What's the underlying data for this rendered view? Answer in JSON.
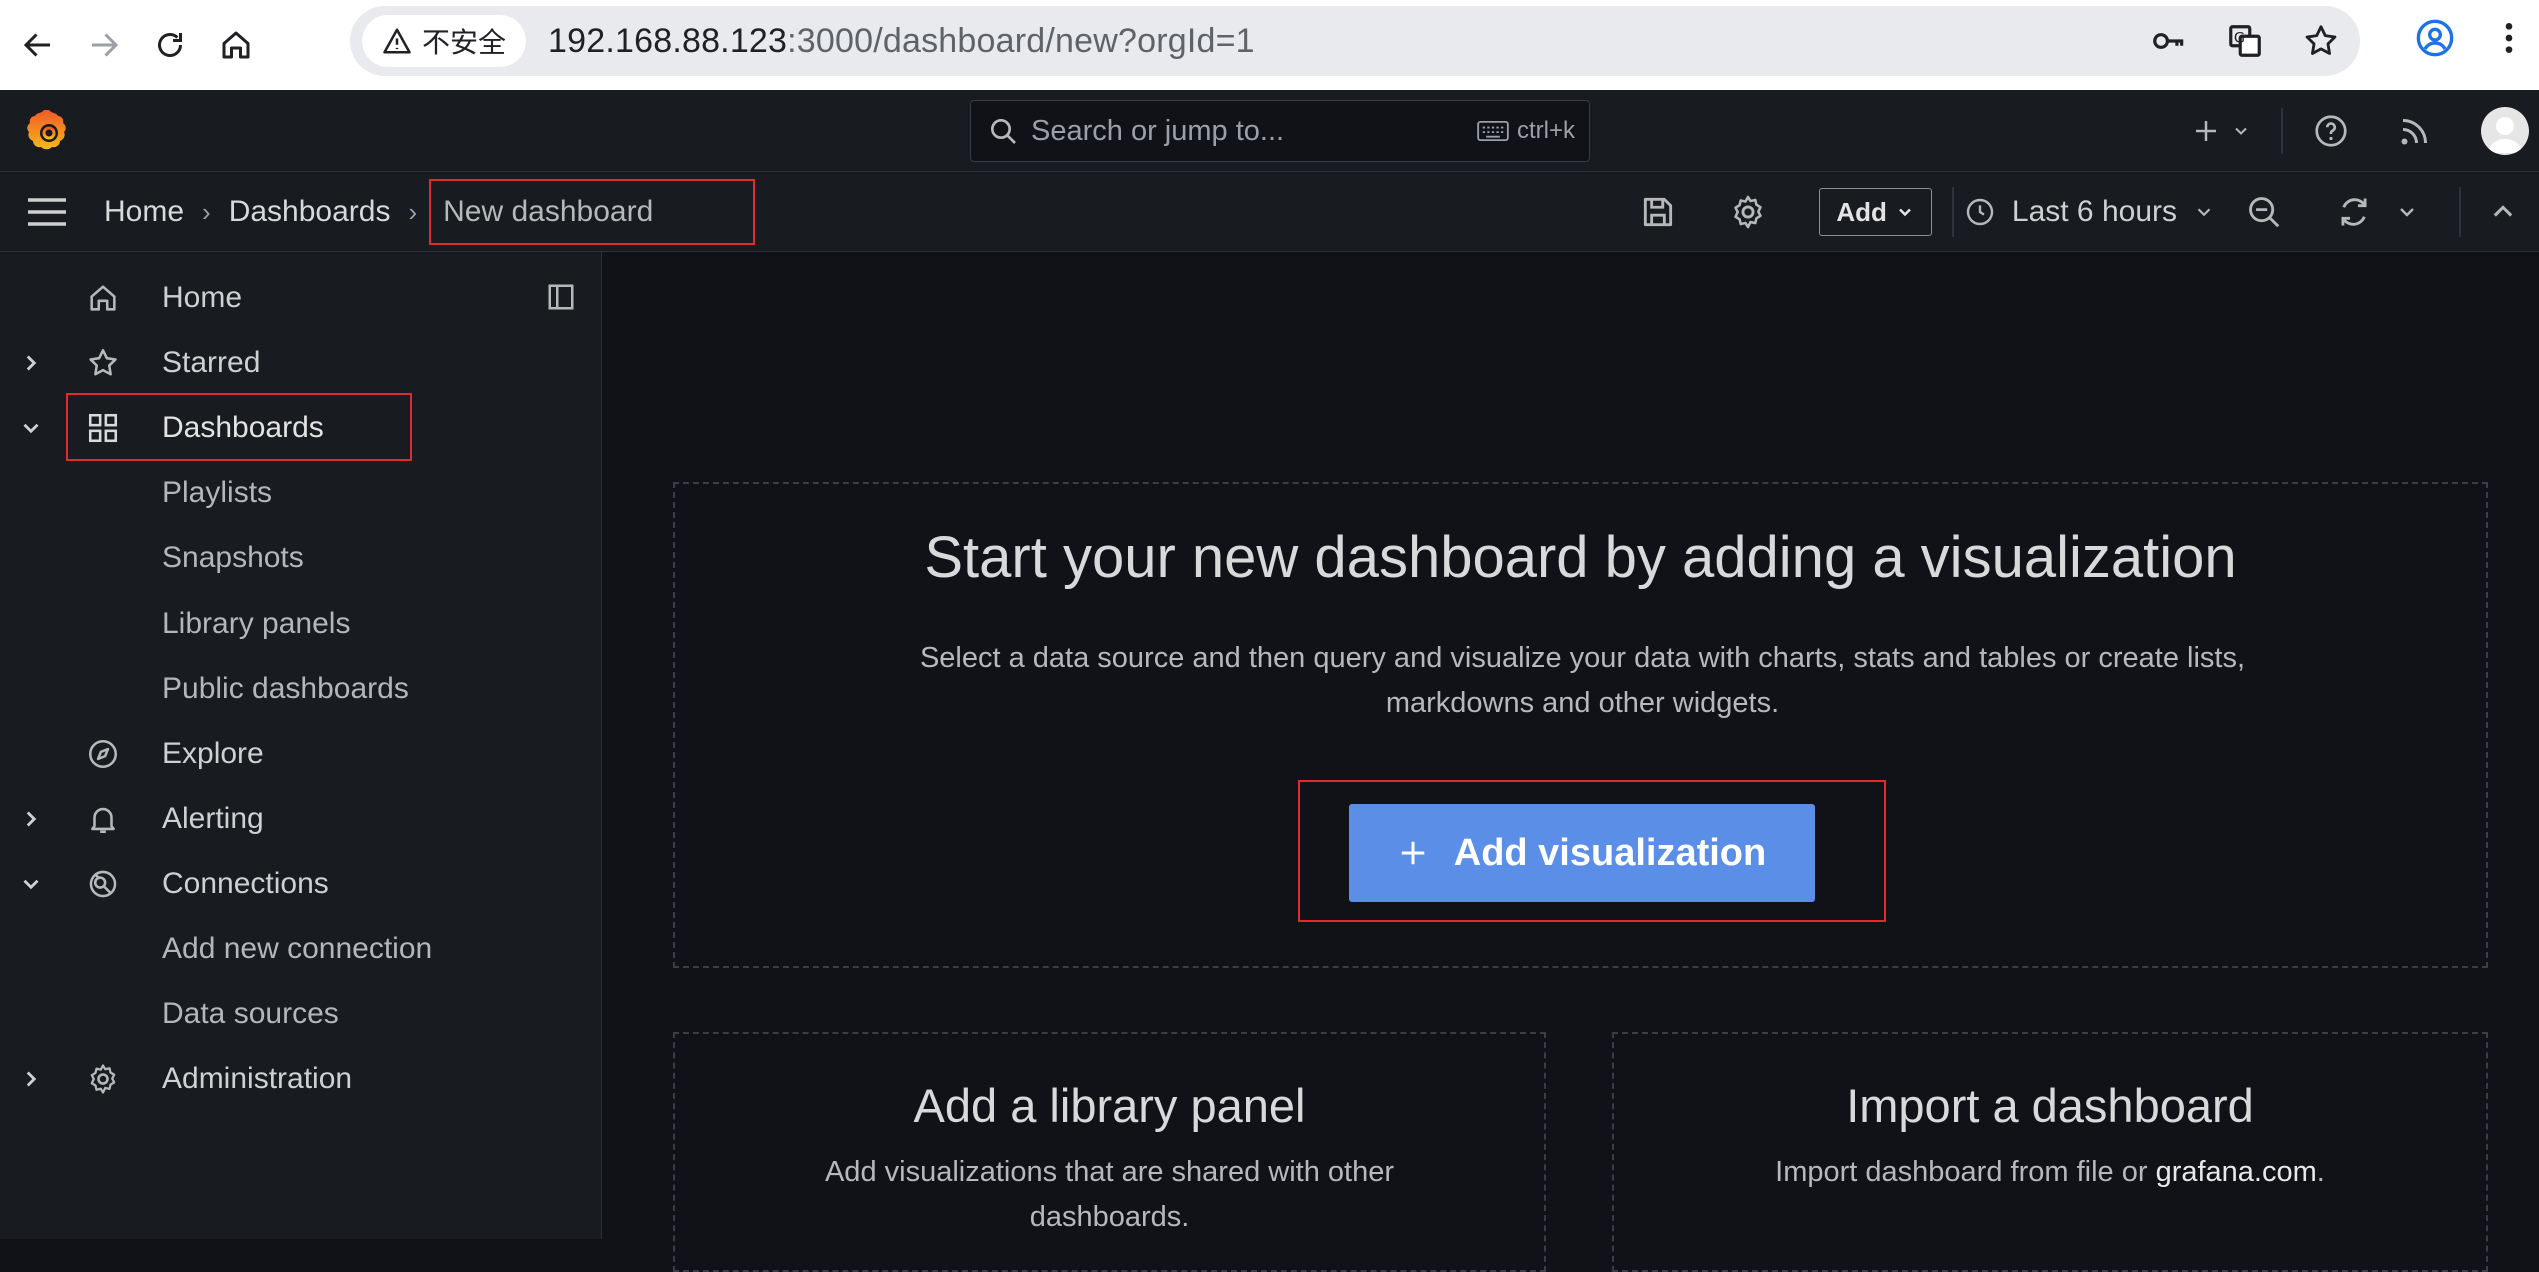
{
  "browser": {
    "insecure_label": "不安全",
    "url_host": "192.168.88.123",
    "url_rest": ":3000/dashboard/new?orgId=1"
  },
  "topbar": {
    "search_placeholder": "Search or jump to...",
    "search_shortcut": "ctrl+k"
  },
  "breadcrumb": {
    "items": [
      "Home",
      "Dashboards",
      "New dashboard"
    ]
  },
  "toolbar": {
    "add_label": "Add",
    "time_range": "Last 6 hours"
  },
  "sidebar": {
    "items": [
      {
        "label": "Home",
        "icon": "home-icon"
      },
      {
        "label": "Starred",
        "icon": "star-icon",
        "chevron": "right"
      },
      {
        "label": "Dashboards",
        "icon": "apps-icon",
        "chevron": "down"
      },
      {
        "label": "Playlists"
      },
      {
        "label": "Snapshots"
      },
      {
        "label": "Library panels"
      },
      {
        "label": "Public dashboards"
      },
      {
        "label": "Explore",
        "icon": "compass-icon"
      },
      {
        "label": "Alerting",
        "icon": "bell-icon",
        "chevron": "right"
      },
      {
        "label": "Connections",
        "icon": "connections-icon",
        "chevron": "down"
      },
      {
        "label": "Add new connection"
      },
      {
        "label": "Data sources"
      },
      {
        "label": "Administration",
        "icon": "cog-icon",
        "chevron": "right"
      }
    ]
  },
  "main": {
    "empty_title": "Start your new dashboard by adding a visualization",
    "empty_desc": "Select a data source and then query and visualize your data with charts, stats and tables or create lists, markdowns and other widgets.",
    "add_viz_label": "Add visualization",
    "library_title": "Add a library panel",
    "library_desc": "Add visualizations that are shared with other dashboards.",
    "import_title": "Import a dashboard",
    "import_desc_prefix": "Import dashboard from file or ",
    "import_link": "grafana.com",
    "import_desc_suffix": "."
  },
  "colors": {
    "accent": "#5b8ee6",
    "highlight": "#e02b2b",
    "background": "#111217"
  }
}
